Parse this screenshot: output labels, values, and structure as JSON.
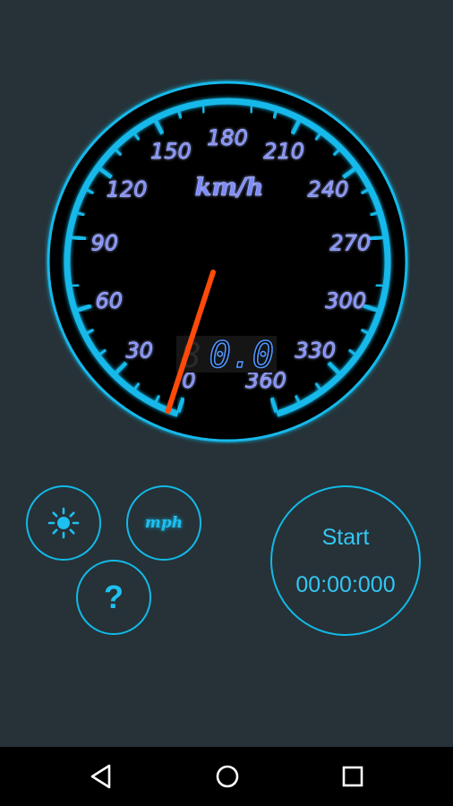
{
  "speedometer": {
    "unit": "km/h",
    "scale_labels": [
      "0",
      "30",
      "60",
      "90",
      "120",
      "150",
      "180",
      "210",
      "240",
      "270",
      "300",
      "330",
      "360"
    ],
    "scale_max": 360,
    "needle_value": 0,
    "digital_readout": "0.0",
    "digital_ghost": "88",
    "colors": {
      "ring": "#13b9ea",
      "scale_text": "#7d8cff",
      "needle": "#ff4a0a",
      "digital": "#4f95ff",
      "face": "#000000"
    }
  },
  "controls": {
    "brightness_icon": "sun-icon",
    "unit_toggle_label": "mph",
    "help_label": "?",
    "start_label": "Start",
    "timer_value": "00:00:000"
  },
  "navbar": {
    "back_icon": "back-triangle-icon",
    "home_icon": "home-circle-icon",
    "recents_icon": "recents-square-icon"
  }
}
